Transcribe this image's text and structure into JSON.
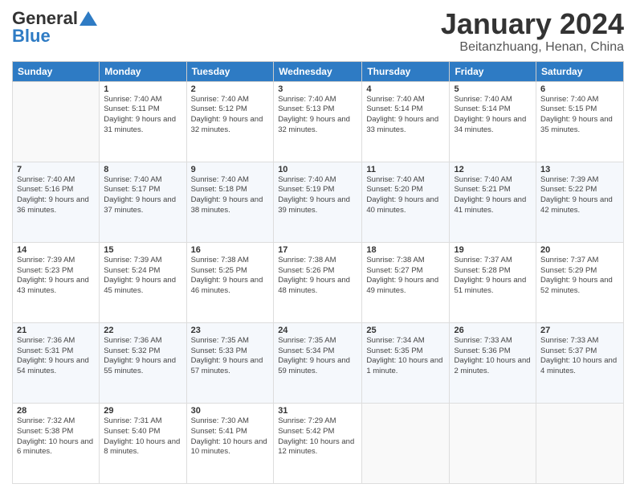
{
  "header": {
    "logo_line1": "General",
    "logo_line2": "Blue",
    "month": "January 2024",
    "location": "Beitanzhuang, Henan, China"
  },
  "days_of_week": [
    "Sunday",
    "Monday",
    "Tuesday",
    "Wednesday",
    "Thursday",
    "Friday",
    "Saturday"
  ],
  "weeks": [
    [
      {
        "day": "",
        "sunrise": "",
        "sunset": "",
        "daylight": ""
      },
      {
        "day": "1",
        "sunrise": "Sunrise: 7:40 AM",
        "sunset": "Sunset: 5:11 PM",
        "daylight": "Daylight: 9 hours and 31 minutes."
      },
      {
        "day": "2",
        "sunrise": "Sunrise: 7:40 AM",
        "sunset": "Sunset: 5:12 PM",
        "daylight": "Daylight: 9 hours and 32 minutes."
      },
      {
        "day": "3",
        "sunrise": "Sunrise: 7:40 AM",
        "sunset": "Sunset: 5:13 PM",
        "daylight": "Daylight: 9 hours and 32 minutes."
      },
      {
        "day": "4",
        "sunrise": "Sunrise: 7:40 AM",
        "sunset": "Sunset: 5:14 PM",
        "daylight": "Daylight: 9 hours and 33 minutes."
      },
      {
        "day": "5",
        "sunrise": "Sunrise: 7:40 AM",
        "sunset": "Sunset: 5:14 PM",
        "daylight": "Daylight: 9 hours and 34 minutes."
      },
      {
        "day": "6",
        "sunrise": "Sunrise: 7:40 AM",
        "sunset": "Sunset: 5:15 PM",
        "daylight": "Daylight: 9 hours and 35 minutes."
      }
    ],
    [
      {
        "day": "7",
        "sunrise": "Sunrise: 7:40 AM",
        "sunset": "Sunset: 5:16 PM",
        "daylight": "Daylight: 9 hours and 36 minutes."
      },
      {
        "day": "8",
        "sunrise": "Sunrise: 7:40 AM",
        "sunset": "Sunset: 5:17 PM",
        "daylight": "Daylight: 9 hours and 37 minutes."
      },
      {
        "day": "9",
        "sunrise": "Sunrise: 7:40 AM",
        "sunset": "Sunset: 5:18 PM",
        "daylight": "Daylight: 9 hours and 38 minutes."
      },
      {
        "day": "10",
        "sunrise": "Sunrise: 7:40 AM",
        "sunset": "Sunset: 5:19 PM",
        "daylight": "Daylight: 9 hours and 39 minutes."
      },
      {
        "day": "11",
        "sunrise": "Sunrise: 7:40 AM",
        "sunset": "Sunset: 5:20 PM",
        "daylight": "Daylight: 9 hours and 40 minutes."
      },
      {
        "day": "12",
        "sunrise": "Sunrise: 7:40 AM",
        "sunset": "Sunset: 5:21 PM",
        "daylight": "Daylight: 9 hours and 41 minutes."
      },
      {
        "day": "13",
        "sunrise": "Sunrise: 7:39 AM",
        "sunset": "Sunset: 5:22 PM",
        "daylight": "Daylight: 9 hours and 42 minutes."
      }
    ],
    [
      {
        "day": "14",
        "sunrise": "Sunrise: 7:39 AM",
        "sunset": "Sunset: 5:23 PM",
        "daylight": "Daylight: 9 hours and 43 minutes."
      },
      {
        "day": "15",
        "sunrise": "Sunrise: 7:39 AM",
        "sunset": "Sunset: 5:24 PM",
        "daylight": "Daylight: 9 hours and 45 minutes."
      },
      {
        "day": "16",
        "sunrise": "Sunrise: 7:38 AM",
        "sunset": "Sunset: 5:25 PM",
        "daylight": "Daylight: 9 hours and 46 minutes."
      },
      {
        "day": "17",
        "sunrise": "Sunrise: 7:38 AM",
        "sunset": "Sunset: 5:26 PM",
        "daylight": "Daylight: 9 hours and 48 minutes."
      },
      {
        "day": "18",
        "sunrise": "Sunrise: 7:38 AM",
        "sunset": "Sunset: 5:27 PM",
        "daylight": "Daylight: 9 hours and 49 minutes."
      },
      {
        "day": "19",
        "sunrise": "Sunrise: 7:37 AM",
        "sunset": "Sunset: 5:28 PM",
        "daylight": "Daylight: 9 hours and 51 minutes."
      },
      {
        "day": "20",
        "sunrise": "Sunrise: 7:37 AM",
        "sunset": "Sunset: 5:29 PM",
        "daylight": "Daylight: 9 hours and 52 minutes."
      }
    ],
    [
      {
        "day": "21",
        "sunrise": "Sunrise: 7:36 AM",
        "sunset": "Sunset: 5:31 PM",
        "daylight": "Daylight: 9 hours and 54 minutes."
      },
      {
        "day": "22",
        "sunrise": "Sunrise: 7:36 AM",
        "sunset": "Sunset: 5:32 PM",
        "daylight": "Daylight: 9 hours and 55 minutes."
      },
      {
        "day": "23",
        "sunrise": "Sunrise: 7:35 AM",
        "sunset": "Sunset: 5:33 PM",
        "daylight": "Daylight: 9 hours and 57 minutes."
      },
      {
        "day": "24",
        "sunrise": "Sunrise: 7:35 AM",
        "sunset": "Sunset: 5:34 PM",
        "daylight": "Daylight: 9 hours and 59 minutes."
      },
      {
        "day": "25",
        "sunrise": "Sunrise: 7:34 AM",
        "sunset": "Sunset: 5:35 PM",
        "daylight": "Daylight: 10 hours and 1 minute."
      },
      {
        "day": "26",
        "sunrise": "Sunrise: 7:33 AM",
        "sunset": "Sunset: 5:36 PM",
        "daylight": "Daylight: 10 hours and 2 minutes."
      },
      {
        "day": "27",
        "sunrise": "Sunrise: 7:33 AM",
        "sunset": "Sunset: 5:37 PM",
        "daylight": "Daylight: 10 hours and 4 minutes."
      }
    ],
    [
      {
        "day": "28",
        "sunrise": "Sunrise: 7:32 AM",
        "sunset": "Sunset: 5:38 PM",
        "daylight": "Daylight: 10 hours and 6 minutes."
      },
      {
        "day": "29",
        "sunrise": "Sunrise: 7:31 AM",
        "sunset": "Sunset: 5:40 PM",
        "daylight": "Daylight: 10 hours and 8 minutes."
      },
      {
        "day": "30",
        "sunrise": "Sunrise: 7:30 AM",
        "sunset": "Sunset: 5:41 PM",
        "daylight": "Daylight: 10 hours and 10 minutes."
      },
      {
        "day": "31",
        "sunrise": "Sunrise: 7:29 AM",
        "sunset": "Sunset: 5:42 PM",
        "daylight": "Daylight: 10 hours and 12 minutes."
      },
      {
        "day": "",
        "sunrise": "",
        "sunset": "",
        "daylight": ""
      },
      {
        "day": "",
        "sunrise": "",
        "sunset": "",
        "daylight": ""
      },
      {
        "day": "",
        "sunrise": "",
        "sunset": "",
        "daylight": ""
      }
    ]
  ]
}
